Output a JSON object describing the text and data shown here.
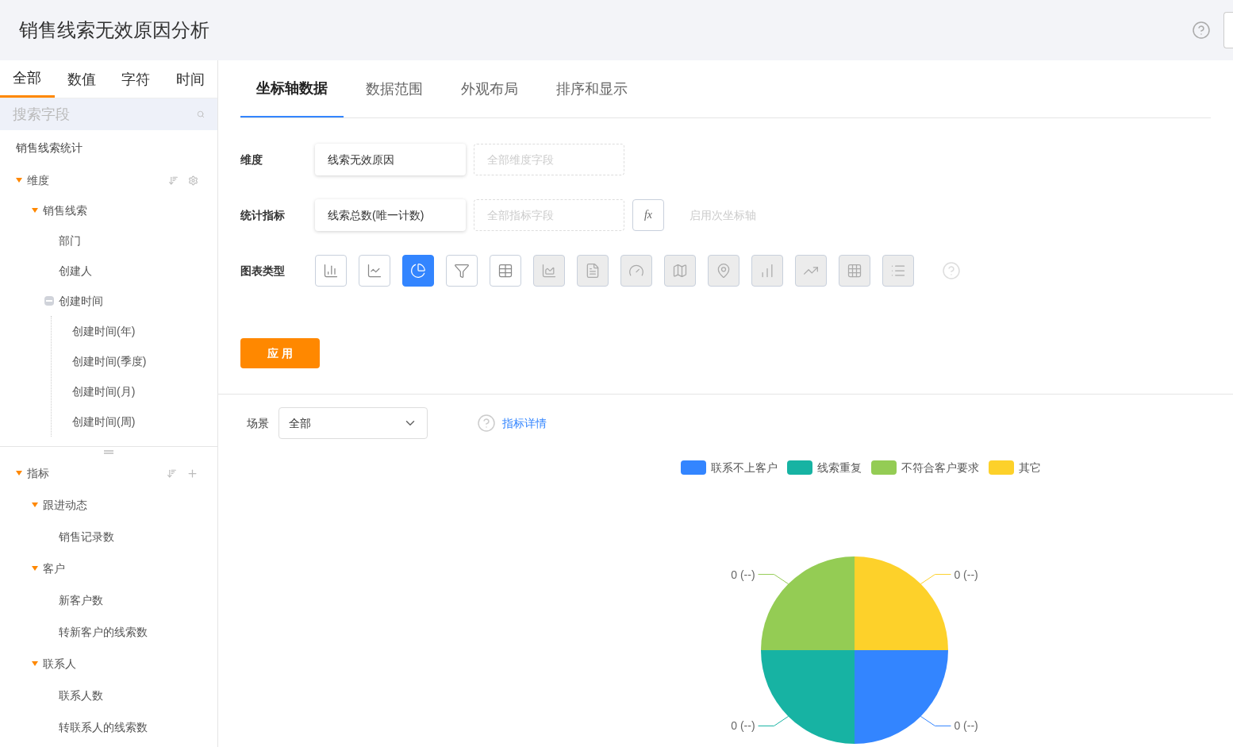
{
  "title": "销售线索无效原因分析",
  "field_tabs": [
    {
      "label": "全部",
      "selected": true
    },
    {
      "label": "数值",
      "selected": false
    },
    {
      "label": "字符",
      "selected": false
    },
    {
      "label": "时间",
      "selected": false
    }
  ],
  "search": {
    "placeholder": "搜索字段"
  },
  "source": "销售线索统计",
  "dimensions": {
    "label": "维度",
    "expanded": true,
    "children": [
      {
        "label": "销售线索",
        "expanded": true,
        "children": [
          {
            "label": "部门"
          },
          {
            "label": "创建人"
          },
          {
            "label": "创建时间",
            "expanded": true,
            "children": [
              {
                "label": "创建时间(年)"
              },
              {
                "label": "创建时间(季度)"
              },
              {
                "label": "创建时间(月)"
              },
              {
                "label": "创建时间(周)"
              }
            ]
          }
        ]
      }
    ]
  },
  "measures": {
    "label": "指标",
    "expanded": true,
    "children": [
      {
        "label": "跟进动态",
        "expanded": true,
        "children": [
          {
            "label": "销售记录数"
          }
        ]
      },
      {
        "label": "客户",
        "expanded": true,
        "children": [
          {
            "label": "新客户数"
          },
          {
            "label": "转新客户的线索数"
          }
        ]
      },
      {
        "label": "联系人",
        "expanded": true,
        "children": [
          {
            "label": "联系人数"
          },
          {
            "label": "转联系人的线索数"
          }
        ]
      }
    ]
  },
  "config_tabs": [
    {
      "label": "坐标轴数据",
      "selected": true
    },
    {
      "label": "数据范围",
      "selected": false
    },
    {
      "label": "外观布局",
      "selected": false
    },
    {
      "label": "排序和显示",
      "selected": false
    }
  ],
  "dimension_row": {
    "label": "维度",
    "value": "线索无效原因",
    "placeholder": "全部维度字段"
  },
  "metric_row": {
    "label": "统计指标",
    "value": "线索总数(唯一计数)",
    "placeholder": "全部指标字段",
    "formula": "fx",
    "secondary_axis": "启用次坐标轴"
  },
  "chart_types": {
    "label": "图表类型",
    "items": [
      {
        "kind": "bar",
        "selected": false,
        "disabled": false
      },
      {
        "kind": "line",
        "selected": false,
        "disabled": false
      },
      {
        "kind": "pie",
        "selected": true,
        "disabled": false
      },
      {
        "kind": "funnel",
        "selected": false,
        "disabled": false
      },
      {
        "kind": "table",
        "selected": false,
        "disabled": false
      },
      {
        "kind": "area",
        "selected": false,
        "disabled": true
      },
      {
        "kind": "card",
        "selected": false,
        "disabled": true
      },
      {
        "kind": "gauge",
        "selected": false,
        "disabled": true
      },
      {
        "kind": "map",
        "selected": false,
        "disabled": true
      },
      {
        "kind": "bubble-map",
        "selected": false,
        "disabled": true
      },
      {
        "kind": "column",
        "selected": false,
        "disabled": true
      },
      {
        "kind": "multi-line",
        "selected": false,
        "disabled": true
      },
      {
        "kind": "heatmap",
        "selected": false,
        "disabled": true
      },
      {
        "kind": "detail",
        "selected": false,
        "disabled": true
      }
    ]
  },
  "apply_button": "应 用",
  "scene": {
    "label": "场景",
    "value": "全部"
  },
  "metric_details": "指标详情",
  "chart": {
    "legend": [
      {
        "label": "联系不上客户",
        "color": "#3385ff"
      },
      {
        "label": "线索重复",
        "color": "#17b3a3"
      },
      {
        "label": "不符合客户要求",
        "color": "#94cc54"
      },
      {
        "label": "其它",
        "color": "#fdd12a"
      }
    ],
    "slice_labels": [
      "0 (--)",
      "0 (--)",
      "0 (--)",
      "0 (--)"
    ]
  }
}
